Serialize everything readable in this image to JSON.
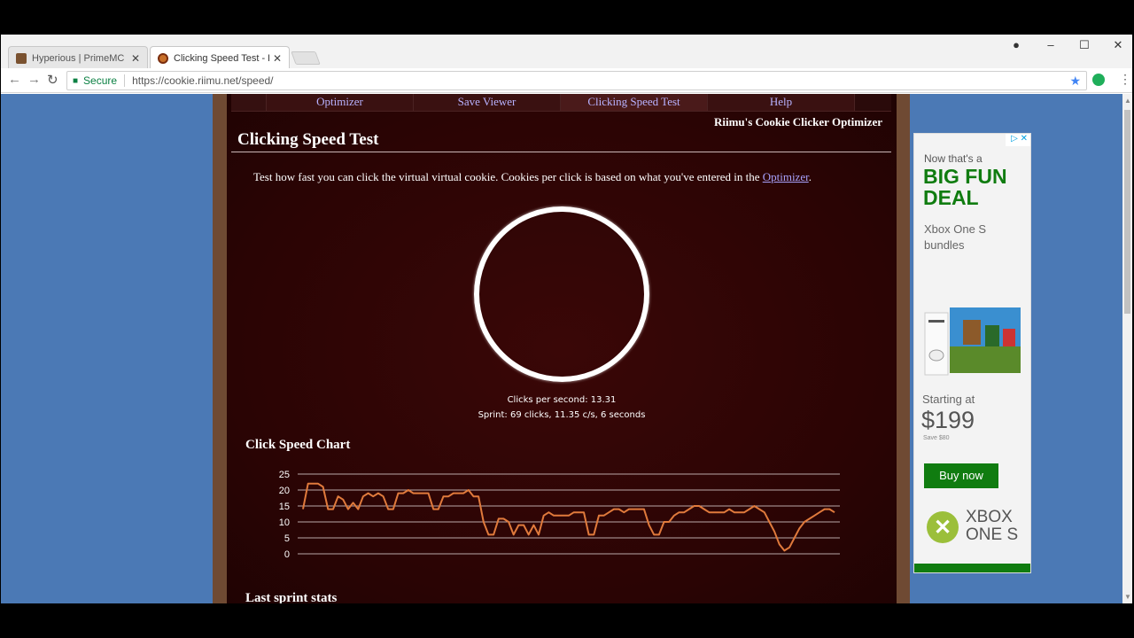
{
  "browser": {
    "tabs": [
      {
        "title": "Hyperious | PrimeMC",
        "active": false,
        "icon": "pickaxe-icon"
      },
      {
        "title": "Clicking Speed Test - Riimu's",
        "active": true,
        "icon": "cookie-icon"
      }
    ],
    "secure_label": "Secure",
    "url": "https://cookie.riimu.net/speed/"
  },
  "site": {
    "nav": [
      "Optimizer",
      "Save Viewer",
      "Clicking Speed Test",
      "Help"
    ],
    "active_nav": "Clicking Speed Test",
    "brand": "Riimu's Cookie Clicker Optimizer",
    "page_title": "Clicking Speed Test",
    "intro_text": "Test how fast you can click the virtual virtual cookie. Cookies per click is based on what you've entered in the ",
    "intro_link": "Optimizer",
    "intro_end": ".",
    "clicks_per_second": "Clicks per second: 13.31",
    "sprint_text": "Sprint: 69 clicks, 11.35 c/s, 6 seconds",
    "chart_heading": "Click Speed Chart",
    "last_sprint_heading": "Last sprint stats"
  },
  "chart_data": {
    "type": "line",
    "title": "",
    "xlabel": "",
    "ylabel": "",
    "ylim": [
      0,
      25
    ],
    "yticks": [
      25,
      20,
      15,
      10,
      5,
      0
    ],
    "grid": true,
    "color": "#e07a3c",
    "series": [
      {
        "values": [
          14,
          22,
          22,
          22,
          21,
          14,
          14,
          18,
          17,
          14,
          16,
          14,
          18,
          19,
          18,
          19,
          18,
          14,
          14,
          19,
          19,
          20,
          19,
          19,
          19,
          19,
          14,
          14,
          18,
          18,
          19,
          19,
          19,
          20,
          18,
          18,
          10,
          6,
          6,
          11,
          11,
          10,
          6,
          9,
          9,
          6,
          9,
          6,
          12,
          13,
          12,
          12,
          12,
          12,
          13,
          13,
          13,
          6,
          6,
          12,
          12,
          13,
          14,
          14,
          13,
          14,
          14,
          14,
          14,
          9,
          6,
          6,
          10,
          10,
          12,
          13,
          13,
          14,
          15,
          15,
          14,
          13,
          13,
          13,
          13,
          14,
          13,
          13,
          13,
          14,
          15,
          14,
          13,
          10,
          7,
          3,
          1,
          2,
          5,
          8,
          10,
          11,
          12,
          13,
          14,
          14,
          13
        ]
      }
    ]
  },
  "ad": {
    "line1": "Now that's a",
    "headline": "BIG FUN DEAL",
    "sub": "Xbox One S bundles",
    "starting": "Starting at",
    "price": "$199",
    "save": "Save $80",
    "cta": "Buy now",
    "logo": "XBOX ONE S"
  }
}
